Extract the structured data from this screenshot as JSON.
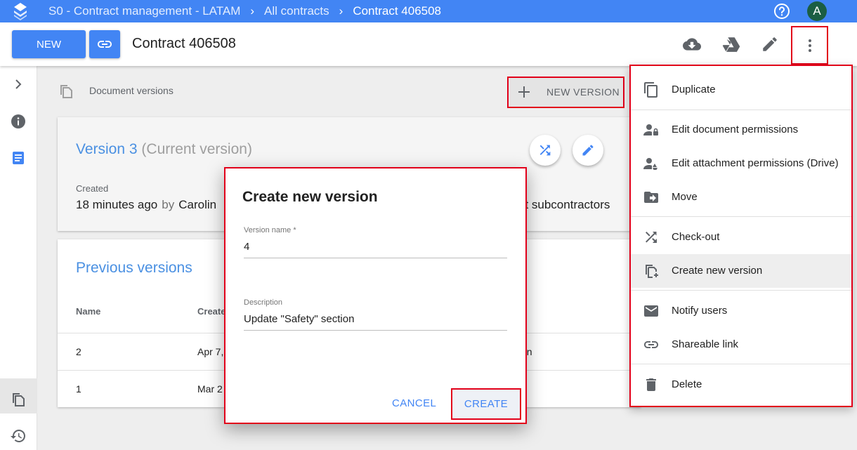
{
  "topbar": {
    "crumbs": [
      "S0 - Contract management - LATAM",
      "All contracts",
      "Contract 406508"
    ],
    "avatar_letter": "A"
  },
  "toolbar": {
    "new_label": "NEW",
    "title": "Contract 406508"
  },
  "versions": {
    "header": "Document versions",
    "new_version_label": "NEW VERSION",
    "current": {
      "title": "Version 3",
      "title_suffix": "(Current version)",
      "created_label": "Created",
      "created_value": "18 minutes ago",
      "by_label": "by",
      "author_partial": "Carolin",
      "right_partial": "nt subcontractors"
    },
    "previous": {
      "title": "Previous versions",
      "columns": [
        "Name",
        "Create"
      ],
      "rows": [
        {
          "name": "2",
          "created": "Apr 7,",
          "extra": "on"
        },
        {
          "name": "1",
          "created": "Mar 2",
          "extra": ""
        }
      ]
    }
  },
  "dialog": {
    "title": "Create new version",
    "version_name_label": "Version name *",
    "version_name_value": "4",
    "description_label": "Description",
    "description_value": "Update \"Safety\" section",
    "cancel_label": "CANCEL",
    "create_label": "CREATE"
  },
  "menu": {
    "items": [
      {
        "label": "Duplicate",
        "icon": "copy-icon"
      },
      {
        "label": "Edit document permissions",
        "icon": "user-lock-icon"
      },
      {
        "label": "Edit attachment permissions (Drive)",
        "icon": "user-drive-icon"
      },
      {
        "label": "Move",
        "icon": "folder-move-icon"
      },
      {
        "label": "Check-out",
        "icon": "shuffle-icon"
      },
      {
        "label": "Create new version",
        "icon": "new-version-icon"
      },
      {
        "label": "Notify users",
        "icon": "mail-icon"
      },
      {
        "label": "Shareable link",
        "icon": "link-icon"
      },
      {
        "label": "Delete",
        "icon": "trash-icon"
      }
    ]
  },
  "colors": {
    "primary": "#4285f4",
    "highlight_border": "#e2001a",
    "link_text": "#4a90e2"
  }
}
